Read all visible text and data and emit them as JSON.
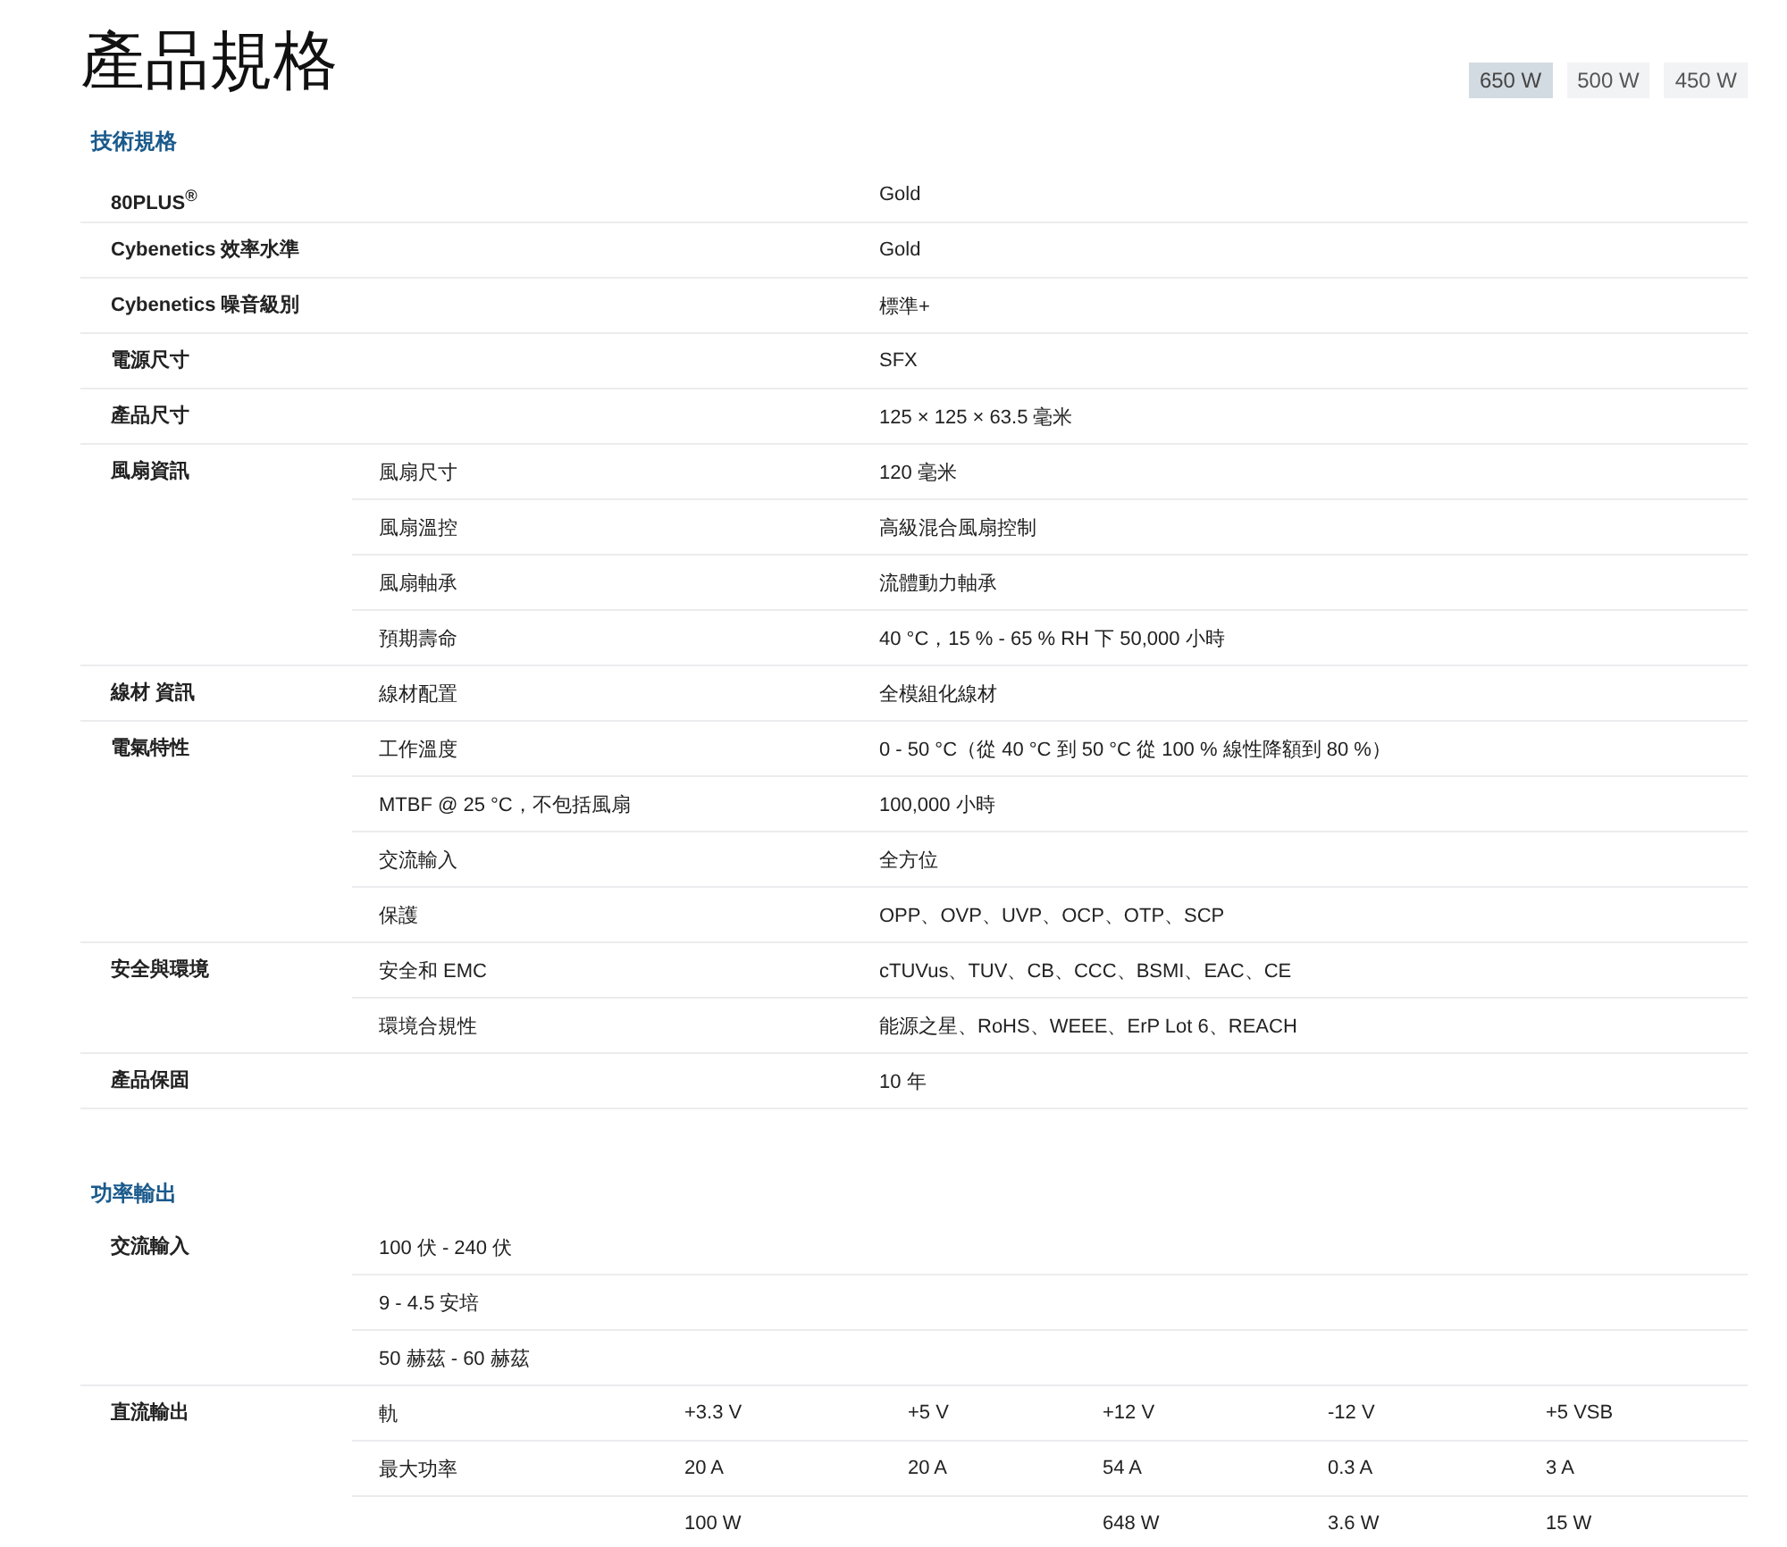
{
  "title": "產品規格",
  "wattage_tabs": [
    {
      "label": "650 W",
      "selected": true
    },
    {
      "label": "500 W",
      "selected": false
    },
    {
      "label": "450 W",
      "selected": false
    }
  ],
  "specs": {
    "heading": "技術規格",
    "groups": [
      {
        "label": "80PLUS$^{®}$",
        "rows": [
          {
            "value": "Gold"
          }
        ]
      },
      {
        "label": "Cybenetics 效率水準",
        "rows": [
          {
            "value": "Gold"
          }
        ]
      },
      {
        "label": "Cybenetics 噪音級別",
        "rows": [
          {
            "value": "標準+"
          }
        ]
      },
      {
        "label": "電源尺寸",
        "rows": [
          {
            "value": "SFX"
          }
        ]
      },
      {
        "label": "產品尺寸",
        "rows": [
          {
            "value": "125 × 125 × 63.5 毫米"
          }
        ]
      },
      {
        "label": "風扇資訊",
        "rows": [
          {
            "name": "風扇尺寸",
            "value": "120 毫米"
          },
          {
            "name": "風扇溫控",
            "value": "高級混合風扇控制"
          },
          {
            "name": "風扇軸承",
            "value": "流體動力軸承"
          },
          {
            "name": "預期壽命",
            "value": "40 °C，15 % - 65 % RH 下 50,000 小時"
          }
        ]
      },
      {
        "label": "線材 資訊",
        "rows": [
          {
            "name": "線材配置",
            "value": "全模組化線材"
          }
        ]
      },
      {
        "label": "電氣特性",
        "rows": [
          {
            "name": "工作溫度",
            "value": "0 - 50 °C（從 40 °C 到 50 °C 從 100 % 線性降額到 80 %）"
          },
          {
            "name": "MTBF @ 25 °C，不包括風扇",
            "value": "100,000 小時"
          },
          {
            "name": "交流輸入",
            "value": "全方位"
          },
          {
            "name": "保護",
            "value": "OPP、OVP、UVP、OCP、OTP、SCP"
          }
        ]
      },
      {
        "label": "安全與環境",
        "rows": [
          {
            "name": "安全和 EMC",
            "value": "cTUVus、TUV、CB、CCC、BSMI、EAC、CE"
          },
          {
            "name": "環境合規性",
            "value": "能源之星、RoHS、WEEE、ErP Lot 6、REACH"
          }
        ]
      },
      {
        "label": "產品保固",
        "rows": [
          {
            "value": "10 年"
          }
        ]
      }
    ]
  },
  "power": {
    "heading": "功率輸出",
    "groups": [
      {
        "label": "交流輸入",
        "rows": [
          {
            "cells": [
              "100 伏 - 240 伏"
            ]
          },
          {
            "cells": [
              "9 - 4.5 安培"
            ]
          },
          {
            "cells": [
              "50 赫茲 - 60 赫茲"
            ]
          }
        ]
      },
      {
        "label": "直流輸出",
        "rows": [
          {
            "cells": [
              "軌",
              "+3.3 V",
              "+5 V",
              "+12 V",
              "-12 V",
              "+5 VSB"
            ]
          },
          {
            "cells": [
              "最大功率",
              "20 A",
              "20 A",
              "54 A",
              "0.3 A",
              "3 A"
            ]
          },
          {
            "cells": [
              null,
              "100 W",
              null,
              "648 W",
              "3.6 W",
              "15 W"
            ]
          }
        ]
      }
    ]
  }
}
